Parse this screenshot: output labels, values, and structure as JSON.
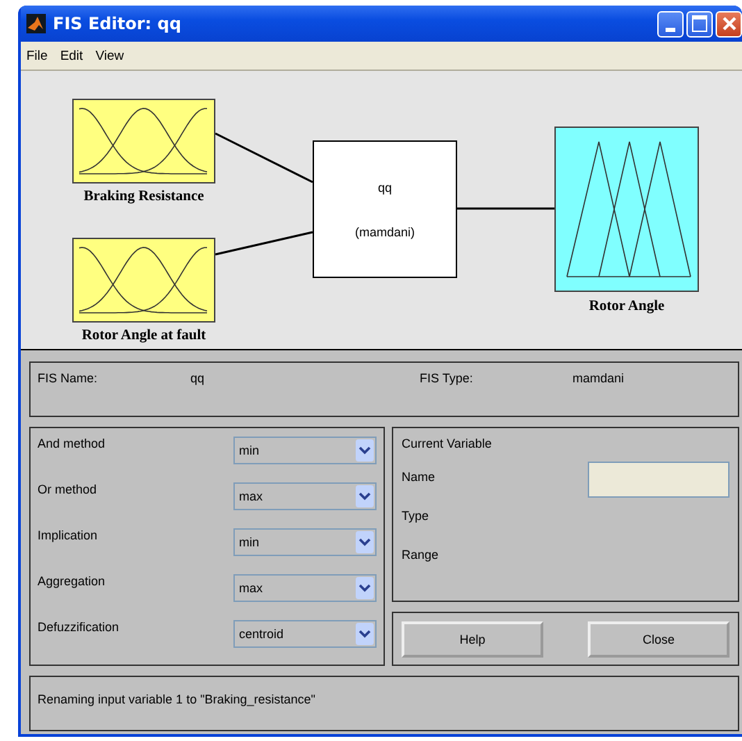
{
  "window": {
    "title": "FIS Editor: qq"
  },
  "menu": [
    "File",
    "Edit",
    "View"
  ],
  "diagram": {
    "inputs": [
      {
        "name": "Braking Resistance",
        "kind": "gauss"
      },
      {
        "name": "Rotor Angle at fault",
        "kind": "gauss"
      }
    ],
    "system": {
      "name": "qq",
      "type": "(mamdani)"
    },
    "outputs": [
      {
        "name": "Rotor Angle",
        "kind": "triangle"
      }
    ]
  },
  "fis_info": {
    "name_label": "FIS Name:",
    "name": "qq",
    "type_label": "FIS Type:",
    "type": "mamdani"
  },
  "methods": [
    {
      "label": "And method",
      "value": "min"
    },
    {
      "label": "Or method",
      "value": "max"
    },
    {
      "label": "Implication",
      "value": "min"
    },
    {
      "label": "Aggregation",
      "value": "max"
    },
    {
      "label": "Defuzzification",
      "value": "centroid"
    }
  ],
  "current_variable": {
    "title": "Current Variable",
    "fields": [
      {
        "label": "Name",
        "kind": "input"
      },
      {
        "label": "Type",
        "kind": "text"
      },
      {
        "label": "Range",
        "kind": "text"
      }
    ]
  },
  "buttons": [
    "Help",
    "Close"
  ],
  "status": "Renaming input variable 1 to \"Braking_resistance\""
}
